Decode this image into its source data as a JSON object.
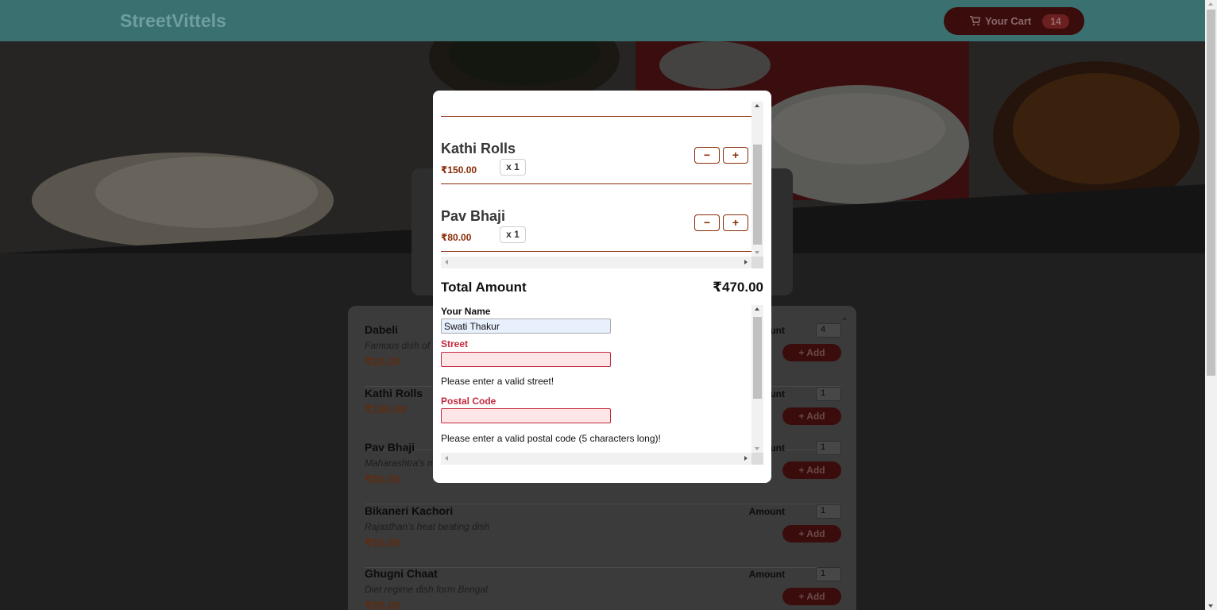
{
  "header": {
    "brand": "StreetVittels",
    "cart_label": "Your Cart",
    "cart_count": "14",
    "cart_icon": "cart-icon"
  },
  "meals": [
    {
      "name": "Dabeli",
      "description": "Famous dish of G",
      "price": "₹20.00",
      "amount_label": "Amount",
      "amount": "4",
      "add_label": "+ Add"
    },
    {
      "name": "Kathi Rolls",
      "description": "",
      "price": "₹150.00",
      "amount_label": "Amount",
      "amount": "1",
      "add_label": "+ Add"
    },
    {
      "name": "Pav Bhaji",
      "description": "Maharashtra's m",
      "price": "₹80.00",
      "amount_label": "Amount",
      "amount": "1",
      "add_label": "+ Add"
    },
    {
      "name": "Bikaneri Kachori",
      "description": "Rajasthan's heat beating dish",
      "price": "₹65.00",
      "amount_label": "Amount",
      "amount": "1",
      "add_label": "+ Add"
    },
    {
      "name": "Ghugni Chaat",
      "description": "Diet regime dish form Bengal",
      "price": "₹85.00",
      "amount_label": "Amount",
      "amount": "1",
      "add_label": "+ Add"
    }
  ],
  "cart_modal": {
    "items": [
      {
        "name": "Kathi Rolls",
        "price": "₹150.00",
        "quantity": "x 1",
        "minus": "−",
        "plus": "+"
      },
      {
        "name": "Pav Bhaji",
        "price": "₹80.00",
        "quantity": "x 1",
        "minus": "−",
        "plus": "+"
      }
    ],
    "total_label": "Total Amount",
    "total_value": "₹470.00",
    "form": {
      "name_label": "Your Name",
      "name_value": "Swati Thakur",
      "street_label": "Street",
      "street_value": "",
      "street_error": "Please enter a valid street!",
      "postal_label": "Postal Code",
      "postal_value": "",
      "postal_error": "Please enter a valid postal code (5 characters long)!"
    }
  },
  "colors": {
    "header": "#3a7070",
    "accent": "#8a2b06",
    "invalid": "#c4293d"
  }
}
